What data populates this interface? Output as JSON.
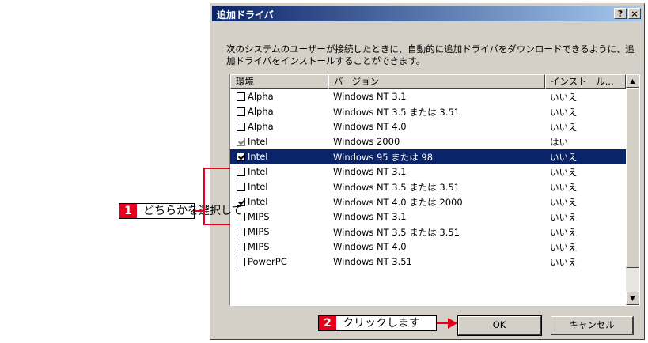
{
  "dialog": {
    "title": "追加ドライバ",
    "help_label": "?",
    "close_label": "×",
    "description": "次のシステムのユーザーが接続したときに、自動的に追加ドライバをダウンロードできるように、追加ドライバをインストールすることができます。",
    "columns": [
      "環境",
      "バージョン",
      "インストール..."
    ],
    "rows": [
      {
        "env": "Alpha",
        "version": "Windows NT 3.1",
        "installed": "いいえ",
        "checked": false,
        "disabled": false,
        "selected": false
      },
      {
        "env": "Alpha",
        "version": "Windows NT 3.5 または 3.51",
        "installed": "いいえ",
        "checked": false,
        "disabled": false,
        "selected": false
      },
      {
        "env": "Alpha",
        "version": "Windows NT 4.0",
        "installed": "いいえ",
        "checked": false,
        "disabled": false,
        "selected": false
      },
      {
        "env": "Intel",
        "version": "Windows 2000",
        "installed": "はい",
        "checked": true,
        "disabled": true,
        "selected": false
      },
      {
        "env": "Intel",
        "version": "Windows 95 または 98",
        "installed": "いいえ",
        "checked": true,
        "disabled": false,
        "selected": true
      },
      {
        "env": "Intel",
        "version": "Windows NT 3.1",
        "installed": "いいえ",
        "checked": false,
        "disabled": false,
        "selected": false
      },
      {
        "env": "Intel",
        "version": "Windows NT 3.5 または 3.51",
        "installed": "いいえ",
        "checked": false,
        "disabled": false,
        "selected": false
      },
      {
        "env": "Intel",
        "version": "Windows NT 4.0 または 2000",
        "installed": "いいえ",
        "checked": true,
        "disabled": false,
        "selected": false
      },
      {
        "env": "MIPS",
        "version": "Windows NT 3.1",
        "installed": "いいえ",
        "checked": false,
        "disabled": false,
        "selected": false
      },
      {
        "env": "MIPS",
        "version": "Windows NT 3.5 または 3.51",
        "installed": "いいえ",
        "checked": false,
        "disabled": false,
        "selected": false
      },
      {
        "env": "MIPS",
        "version": "Windows NT 4.0",
        "installed": "いいえ",
        "checked": false,
        "disabled": false,
        "selected": false
      },
      {
        "env": "PowerPC",
        "version": "Windows NT 3.51",
        "installed": "いいえ",
        "checked": false,
        "disabled": false,
        "selected": false
      }
    ],
    "ok_label": "OK",
    "cancel_label": "キャンセル"
  },
  "callouts": {
    "step1_num": "1",
    "step1_text": "どちらかを選択して",
    "step2_num": "2",
    "step2_text": "クリックします"
  },
  "colors": {
    "accent_red": "#e6001e",
    "selection": "#0a246a",
    "face": "#d4d0c8"
  }
}
